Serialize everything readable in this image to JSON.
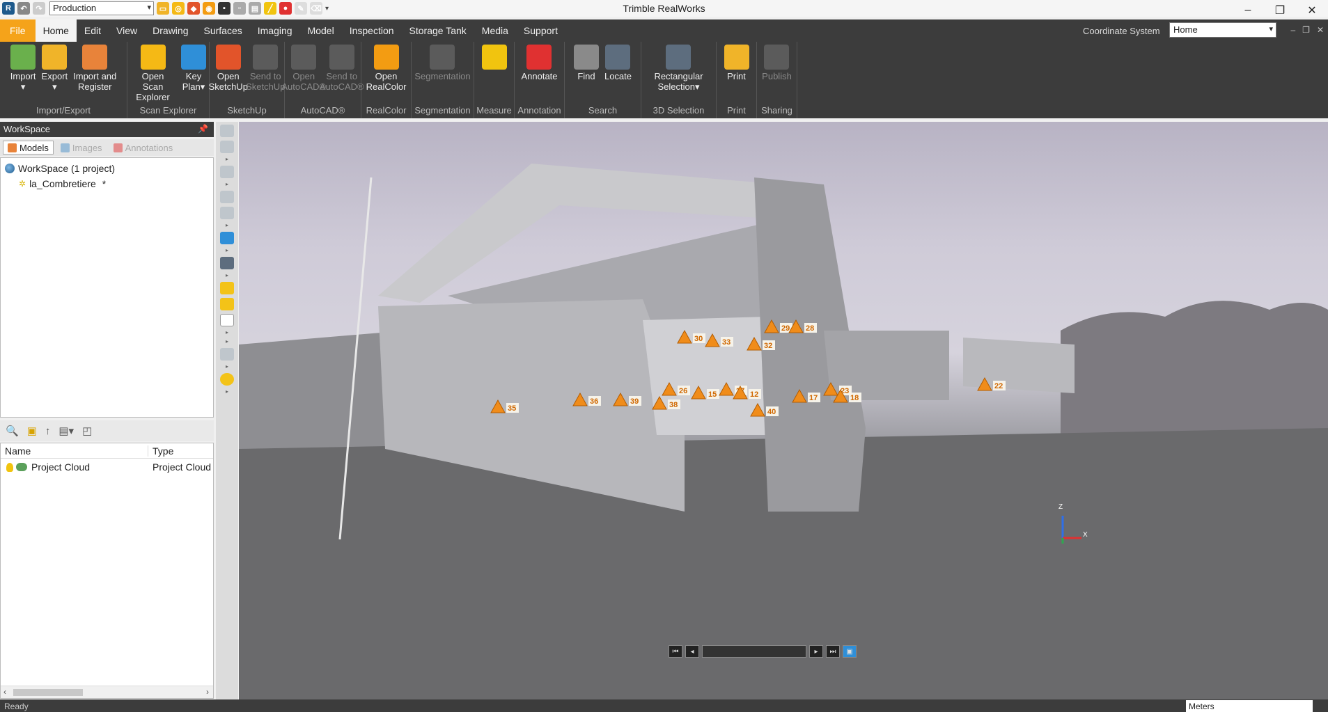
{
  "window": {
    "title": "Trimble RealWorks",
    "project_selector": "Production",
    "controls": [
      "–",
      "❐",
      "✕"
    ]
  },
  "menu": {
    "tabs": [
      "File",
      "Home",
      "Edit",
      "View",
      "Drawing",
      "Surfaces",
      "Imaging",
      "Model",
      "Inspection",
      "Storage Tank",
      "Media",
      "Support"
    ],
    "active_tab": "Home",
    "coordinate_system_label": "Coordinate System",
    "coordinate_system_value": "Home"
  },
  "ribbon": {
    "groups": [
      {
        "label": "Import/Export",
        "buttons": [
          {
            "label": "Import\n▾",
            "icon": "import-icon",
            "color": "#6ab04c",
            "enabled": true
          },
          {
            "label": "Export\n▾",
            "icon": "export-icon",
            "color": "#f0b429",
            "enabled": true
          },
          {
            "label": "Import and\nRegister",
            "icon": "import-register-icon",
            "color": "#e8833a",
            "enabled": true
          }
        ]
      },
      {
        "label": "Scan Explorer",
        "buttons": [
          {
            "label": "Open Scan\nExplorer",
            "icon": "scan-explorer-icon",
            "color": "#f5b915",
            "enabled": true
          },
          {
            "label": "Key\nPlan▾",
            "icon": "key-plan-icon",
            "color": "#2f8fd8",
            "enabled": true
          }
        ]
      },
      {
        "label": "SketchUp",
        "buttons": [
          {
            "label": "Open\nSketchUp",
            "icon": "sketchup-icon",
            "color": "#e2542a",
            "enabled": true
          },
          {
            "label": "Send to\nSketchUp",
            "icon": "send-sketchup-icon",
            "color": "#777",
            "enabled": false
          }
        ]
      },
      {
        "label": "AutoCAD®",
        "buttons": [
          {
            "label": "Open\nAutoCAD®",
            "icon": "autocad-icon",
            "color": "#777",
            "enabled": false
          },
          {
            "label": "Send to\nAutoCAD®",
            "icon": "send-autocad-icon",
            "color": "#777",
            "enabled": false
          }
        ]
      },
      {
        "label": "RealColor",
        "buttons": [
          {
            "label": "Open\nRealColor",
            "icon": "realcolor-icon",
            "color": "#f39c12",
            "enabled": true
          }
        ]
      },
      {
        "label": "Segmentation",
        "buttons": [
          {
            "label": "Segmentation",
            "icon": "segmentation-icon",
            "color": "#777",
            "enabled": false
          }
        ]
      },
      {
        "label": "Measure",
        "buttons": [
          {
            "label": "",
            "icon": "ruler-icon",
            "color": "#f1c40f",
            "enabled": true
          }
        ]
      },
      {
        "label": "Annotation",
        "buttons": [
          {
            "label": "Annotate",
            "icon": "annotate-icon",
            "color": "#e03131",
            "enabled": true
          }
        ]
      },
      {
        "label": "Search",
        "buttons": [
          {
            "label": "Find",
            "icon": "find-icon",
            "color": "#8a8a8a",
            "enabled": true
          },
          {
            "label": "Locate",
            "icon": "locate-icon",
            "color": "#5d6d7e",
            "enabled": true
          }
        ]
      },
      {
        "label": "3D Selection",
        "buttons": [
          {
            "label": "Rectangular\nSelection▾",
            "icon": "rect-selection-icon",
            "color": "#5d6d7e",
            "enabled": true
          }
        ]
      },
      {
        "label": "Print",
        "buttons": [
          {
            "label": "Print",
            "icon": "print-icon",
            "color": "#f0b429",
            "enabled": true
          }
        ]
      },
      {
        "label": "Sharing",
        "buttons": [
          {
            "label": "Publish",
            "icon": "publish-icon",
            "color": "#777",
            "enabled": false
          }
        ]
      }
    ]
  },
  "workspace": {
    "header": "WorkSpace",
    "tabs": [
      {
        "label": "Models",
        "active": true,
        "color": "#e8833a"
      },
      {
        "label": "Images",
        "active": false,
        "color": "#4a90c8"
      },
      {
        "label": "Annotations",
        "active": false,
        "color": "#e03131"
      }
    ],
    "tree": {
      "root": "WorkSpace  (1 project)",
      "project": "la_Combretiere",
      "project_suffix": "*"
    }
  },
  "properties": {
    "columns": [
      "Name",
      "Type"
    ],
    "rows": [
      {
        "name": "Project Cloud",
        "type": "Project Cloud"
      }
    ]
  },
  "viewport": {
    "markers": [
      {
        "id": "30"
      },
      {
        "id": "33"
      },
      {
        "id": "32"
      },
      {
        "id": "29"
      },
      {
        "id": "28"
      },
      {
        "id": "35"
      },
      {
        "id": "36"
      },
      {
        "id": "39"
      },
      {
        "id": "38"
      },
      {
        "id": "26"
      },
      {
        "id": "15"
      },
      {
        "id": "27"
      },
      {
        "id": "12"
      },
      {
        "id": "40"
      },
      {
        "id": "17"
      },
      {
        "id": "23"
      },
      {
        "id": "18"
      },
      {
        "id": "22"
      }
    ]
  },
  "status": {
    "text": "Ready",
    "units": "Meters"
  }
}
